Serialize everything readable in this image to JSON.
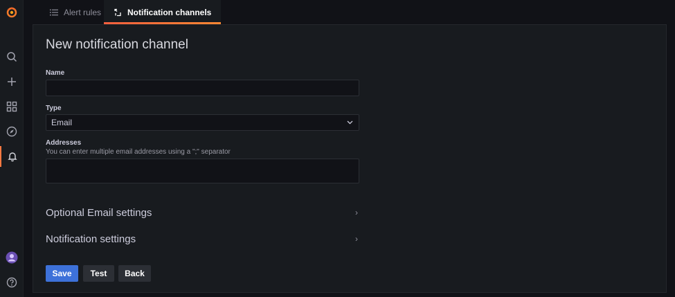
{
  "tabs": [
    {
      "label": "Alert rules",
      "icon": "list-icon",
      "active": false
    },
    {
      "label": "Notification channels",
      "icon": "bell-channel-icon",
      "active": true
    }
  ],
  "page": {
    "title": "New notification channel"
  },
  "form": {
    "name": {
      "label": "Name",
      "value": ""
    },
    "type": {
      "label": "Type",
      "value": "Email"
    },
    "addresses": {
      "label": "Addresses",
      "description": "You can enter multiple email addresses using a \";\" separator",
      "value": ""
    }
  },
  "sections": {
    "optional": "Optional Email settings",
    "notification": "Notification settings"
  },
  "buttons": {
    "save": "Save",
    "test": "Test",
    "back": "Back"
  },
  "colors": {
    "accent": "#ff7941",
    "primary": "#3d71d9",
    "background": "#111217",
    "panel": "#181b1f"
  }
}
